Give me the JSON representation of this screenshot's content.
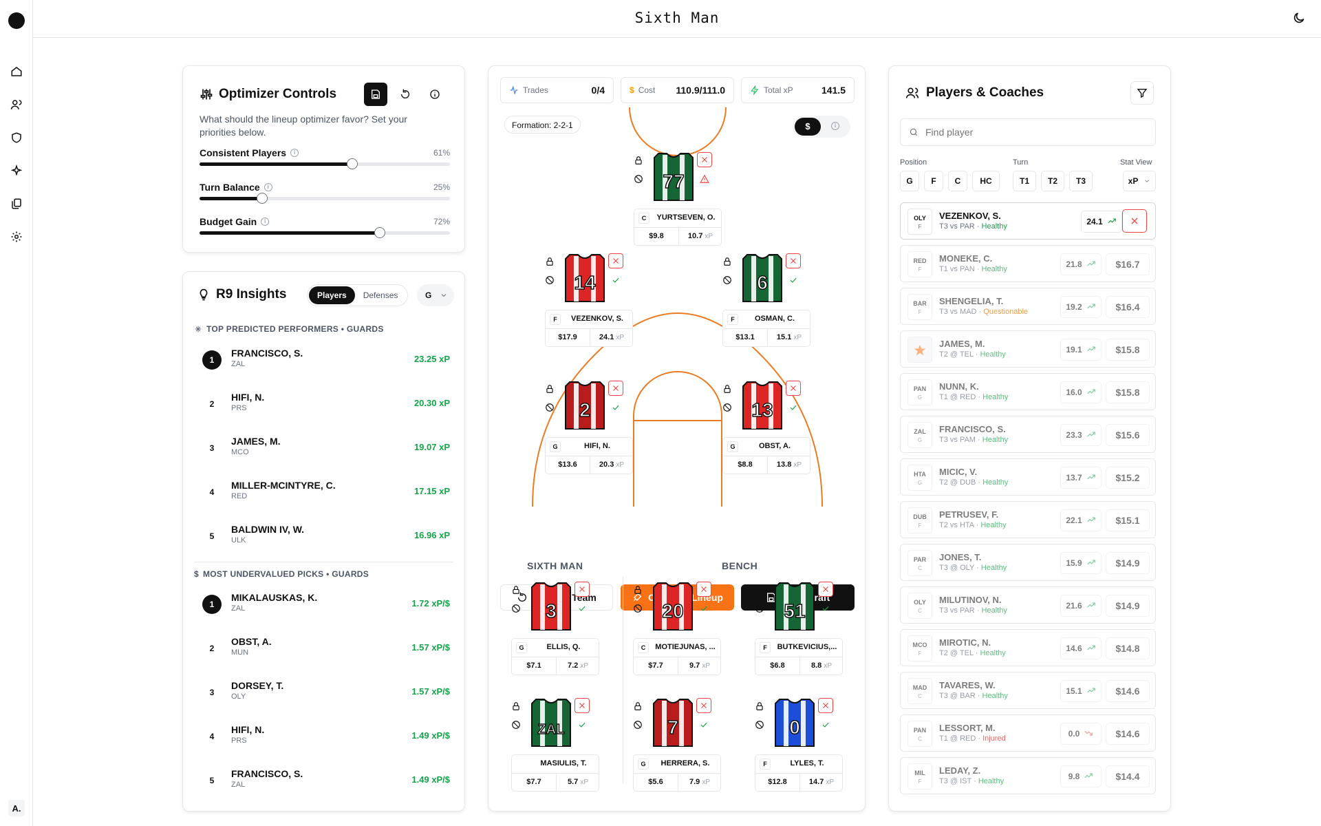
{
  "app": {
    "title": "Sixth Man",
    "avatar": "A."
  },
  "optimizer": {
    "title": "Optimizer Controls",
    "description": "What should the lineup optimizer favor? Set your priorities below.",
    "sliders": [
      {
        "label": "Consistent Players",
        "value": 61,
        "display": "61%"
      },
      {
        "label": "Turn Balance",
        "value": 25,
        "display": "25%"
      },
      {
        "label": "Budget Gain",
        "value": 72,
        "display": "72%"
      }
    ]
  },
  "insights": {
    "title": "R9 Insights",
    "tabs": [
      "Players",
      "Defenses"
    ],
    "position": "G",
    "top_title": "TOP PREDICTED PERFORMERS • GUARDS",
    "top": [
      {
        "rank": "1",
        "name": "FRANCISCO, S.",
        "team": "ZAL",
        "value": "23.25 xP"
      },
      {
        "rank": "2",
        "name": "HIFI, N.",
        "team": "PRS",
        "value": "20.30 xP"
      },
      {
        "rank": "3",
        "name": "JAMES, M.",
        "team": "MCO",
        "value": "19.07 xP"
      },
      {
        "rank": "4",
        "name": "MILLER-MCINTYRE, C.",
        "team": "RED",
        "value": "17.15 xP"
      },
      {
        "rank": "5",
        "name": "BALDWIN IV, W.",
        "team": "ULK",
        "value": "16.96 xP"
      }
    ],
    "under_title": "MOST UNDERVALUED PICKS • GUARDS",
    "under": [
      {
        "rank": "1",
        "name": "MIKALAUSKAS, K.",
        "team": "ZAL",
        "value": "1.72 xP/$"
      },
      {
        "rank": "2",
        "name": "OBST, A.",
        "team": "MUN",
        "value": "1.57 xP/$"
      },
      {
        "rank": "3",
        "name": "DORSEY, T.",
        "team": "OLY",
        "value": "1.57 xP/$"
      },
      {
        "rank": "4",
        "name": "HIFI, N.",
        "team": "PRS",
        "value": "1.49 xP/$"
      },
      {
        "rank": "5",
        "name": "FRANCISCO, S.",
        "team": "ZAL",
        "value": "1.49 xP/$"
      }
    ]
  },
  "team": {
    "stats": [
      {
        "label": "Trades",
        "value": "0/4"
      },
      {
        "label": "Cost",
        "value": "110.9/111.0"
      },
      {
        "label": "Total xP",
        "value": "141.5"
      }
    ],
    "formation": "Formation: 2-2-1",
    "toggle": "$",
    "court": [
      {
        "num": "77",
        "pos": "C",
        "name": "YURTSEVEN, O.",
        "price": "$9.8",
        "xp": "10.7",
        "color": "#166534",
        "warn": true
      },
      {
        "num": "14",
        "pos": "F",
        "name": "VEZENKOV, S.",
        "price": "$17.9",
        "xp": "24.1",
        "color": "#dc2626"
      },
      {
        "num": "6",
        "pos": "F",
        "name": "OSMAN, C.",
        "price": "$13.1",
        "xp": "15.1",
        "color": "#166534"
      },
      {
        "num": "2",
        "pos": "G",
        "name": "HIFI, N.",
        "price": "$13.6",
        "xp": "20.3",
        "color": "#b91c1c"
      },
      {
        "num": "13",
        "pos": "G",
        "name": "OBST, A.",
        "price": "$8.8",
        "xp": "13.8",
        "color": "#dc2626"
      }
    ],
    "buttons": {
      "restore": "Restore Team",
      "optimize": "Optimize Lineup",
      "save": "Save Draft"
    },
    "sixth_label": "SIXTH MAN",
    "bench_label": "BENCH",
    "bench": [
      {
        "num": "3",
        "pos": "G",
        "name": "ELLIS, Q.",
        "price": "$7.1",
        "xp": "7.2",
        "color": "#dc2626"
      },
      {
        "num": "20",
        "pos": "C",
        "name": "MOTIEJUNAS, ...",
        "price": "$7.7",
        "xp": "9.7",
        "color": "#dc2626"
      },
      {
        "num": "51",
        "pos": "F",
        "name": "BUTKEVICIUS,...",
        "price": "$6.8",
        "xp": "8.8",
        "color": "#166534"
      },
      {
        "num": "ZAL",
        "pos": "",
        "name": "MASIULIS, T.",
        "price": "$7.7",
        "xp": "5.7",
        "color": "#166534"
      },
      {
        "num": "7",
        "pos": "G",
        "name": "HERRERA, S.",
        "price": "$5.6",
        "xp": "7.9",
        "color": "#b91c1c"
      },
      {
        "num": "0",
        "pos": "F",
        "name": "LYLES, T.",
        "price": "$12.8",
        "xp": "14.7",
        "color": "#1d4ed8"
      }
    ],
    "xp_unit": "xP"
  },
  "players": {
    "title": "Players & Coaches",
    "search_placeholder": "Find player",
    "position_label": "Position",
    "positions": [
      "G",
      "F",
      "C",
      "HC"
    ],
    "turn_label": "Turn",
    "turns": [
      "T1",
      "T2",
      "T3"
    ],
    "stat_label": "Stat View",
    "stat_value": "xP",
    "list": [
      {
        "team": "OLY",
        "pos": "F",
        "name": "VEZENKOV, S.",
        "match": "T3 vs PAR",
        "status": "Healthy",
        "xp": "24.1",
        "price": "",
        "selected": true
      },
      {
        "team": "RED",
        "pos": "F",
        "name": "MONEKE, C.",
        "match": "T1 vs PAN",
        "status": "Healthy",
        "xp": "21.8",
        "price": "$16.7"
      },
      {
        "team": "BAR",
        "pos": "F",
        "name": "SHENGELIA, T.",
        "match": "T3 vs MAD",
        "status": "Questionable",
        "xp": "19.2",
        "price": "$16.4"
      },
      {
        "team": "",
        "pos": "",
        "name": "JAMES, M.",
        "match": "T2 @ TEL",
        "status": "Healthy",
        "xp": "19.1",
        "price": "$15.8",
        "star": true
      },
      {
        "team": "PAN",
        "pos": "G",
        "name": "NUNN, K.",
        "match": "T1 @ RED",
        "status": "Healthy",
        "xp": "16.0",
        "price": "$15.8"
      },
      {
        "team": "ZAL",
        "pos": "G",
        "name": "FRANCISCO, S.",
        "match": "T3 vs PAM",
        "status": "Healthy",
        "xp": "23.3",
        "price": "$15.6"
      },
      {
        "team": "HTA",
        "pos": "G",
        "name": "MICIC, V.",
        "match": "T2 @ DUB",
        "status": "Healthy",
        "xp": "13.7",
        "price": "$15.2"
      },
      {
        "team": "DUB",
        "pos": "F",
        "name": "PETRUSEV, F.",
        "match": "T2 vs HTA",
        "status": "Healthy",
        "xp": "22.1",
        "price": "$15.1"
      },
      {
        "team": "PAR",
        "pos": "C",
        "name": "JONES, T.",
        "match": "T3 @ OLY",
        "status": "Healthy",
        "xp": "15.9",
        "price": "$14.9"
      },
      {
        "team": "OLY",
        "pos": "C",
        "name": "MILUTINOV, N.",
        "match": "T3 vs PAR",
        "status": "Healthy",
        "xp": "21.6",
        "price": "$14.9"
      },
      {
        "team": "MCO",
        "pos": "F",
        "name": "MIROTIC, N.",
        "match": "T2 @ TEL",
        "status": "Healthy",
        "xp": "14.6",
        "price": "$14.8"
      },
      {
        "team": "MAD",
        "pos": "C",
        "name": "TAVARES, W.",
        "match": "T3 @ BAR",
        "status": "Healthy",
        "xp": "15.1",
        "price": "$14.6"
      },
      {
        "team": "PAN",
        "pos": "C",
        "name": "LESSORT, M.",
        "match": "T1 @ RED",
        "status": "Injured",
        "xp": "0.0",
        "price": "$14.6",
        "down": true
      },
      {
        "team": "MIL",
        "pos": "F",
        "name": "LEDAY, Z.",
        "match": "T3 @ IST",
        "status": "Healthy",
        "xp": "9.8",
        "price": "$14.4"
      }
    ]
  }
}
